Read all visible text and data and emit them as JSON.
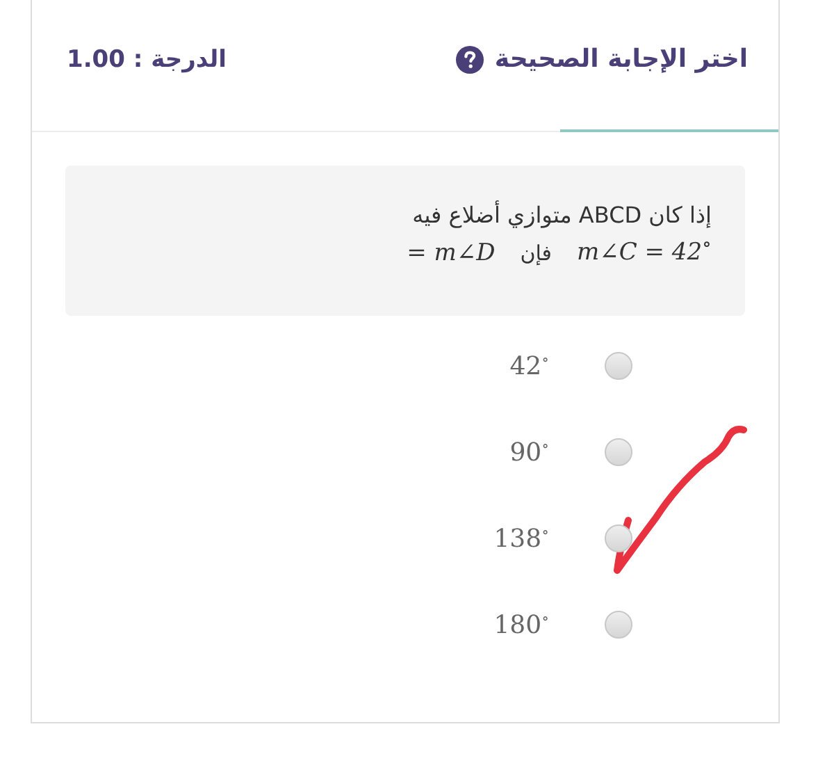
{
  "header": {
    "title": "اختر الإجابة الصحيحة",
    "grade": "الدرجة : 1.00"
  },
  "question": {
    "text": "إذا كان ABCD متوازي أضلاع فيه",
    "condition": "m∠C = 42$^{∘}$",
    "connector": "فإن",
    "target": "= m∠D"
  },
  "options": [
    {
      "label": "42$^{∘}$",
      "selected": false
    },
    {
      "label": "90$^{∘}$",
      "selected": false
    },
    {
      "label": "138$^{∘}$",
      "selected": false
    },
    {
      "label": "180$^{∘}$",
      "selected": false
    }
  ],
  "annotation": {
    "kind": "check-mark"
  }
}
